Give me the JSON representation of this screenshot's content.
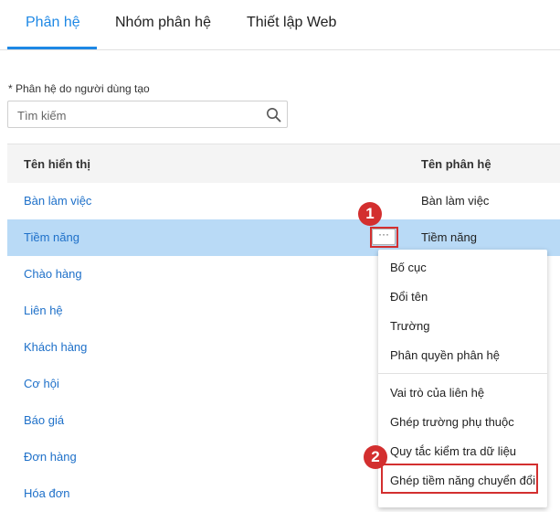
{
  "tabs": [
    {
      "label": "Phân hệ"
    },
    {
      "label": "Nhóm phân hệ"
    },
    {
      "label": "Thiết lập Web"
    }
  ],
  "section": {
    "label": "* Phân hệ do người dùng tạo"
  },
  "search": {
    "placeholder": "Tìm kiếm",
    "icon": "search-icon"
  },
  "table": {
    "headers": {
      "display_name": "Tên hiển thị",
      "module_name": "Tên phân hệ"
    },
    "rows": [
      {
        "display": "Bàn làm việc",
        "module": "Bàn làm việc"
      },
      {
        "display": "Tiềm năng",
        "module": "Tiềm năng",
        "selected": true
      },
      {
        "display": "Chào hàng"
      },
      {
        "display": "Liên hệ"
      },
      {
        "display": "Khách hàng"
      },
      {
        "display": "Cơ hội"
      },
      {
        "display": "Báo giá"
      },
      {
        "display": "Đơn hàng"
      },
      {
        "display": "Hóa đơn"
      }
    ]
  },
  "more_button": {
    "label": "···"
  },
  "menu": {
    "items": [
      "Bố cục",
      "Đổi tên",
      "Trường",
      "Phân quyền phân hệ",
      "Vai trò của liên hệ",
      "Ghép trường phụ thuộc",
      "Quy tắc kiểm tra dữ liệu",
      "Ghép tiềm năng chuyển đổi"
    ]
  },
  "steps": [
    "1",
    "2"
  ],
  "colors": {
    "accent": "#1e88e5",
    "selected_row": "#b9daf6",
    "annotation": "#d32f2f",
    "link": "#1e70c9"
  }
}
